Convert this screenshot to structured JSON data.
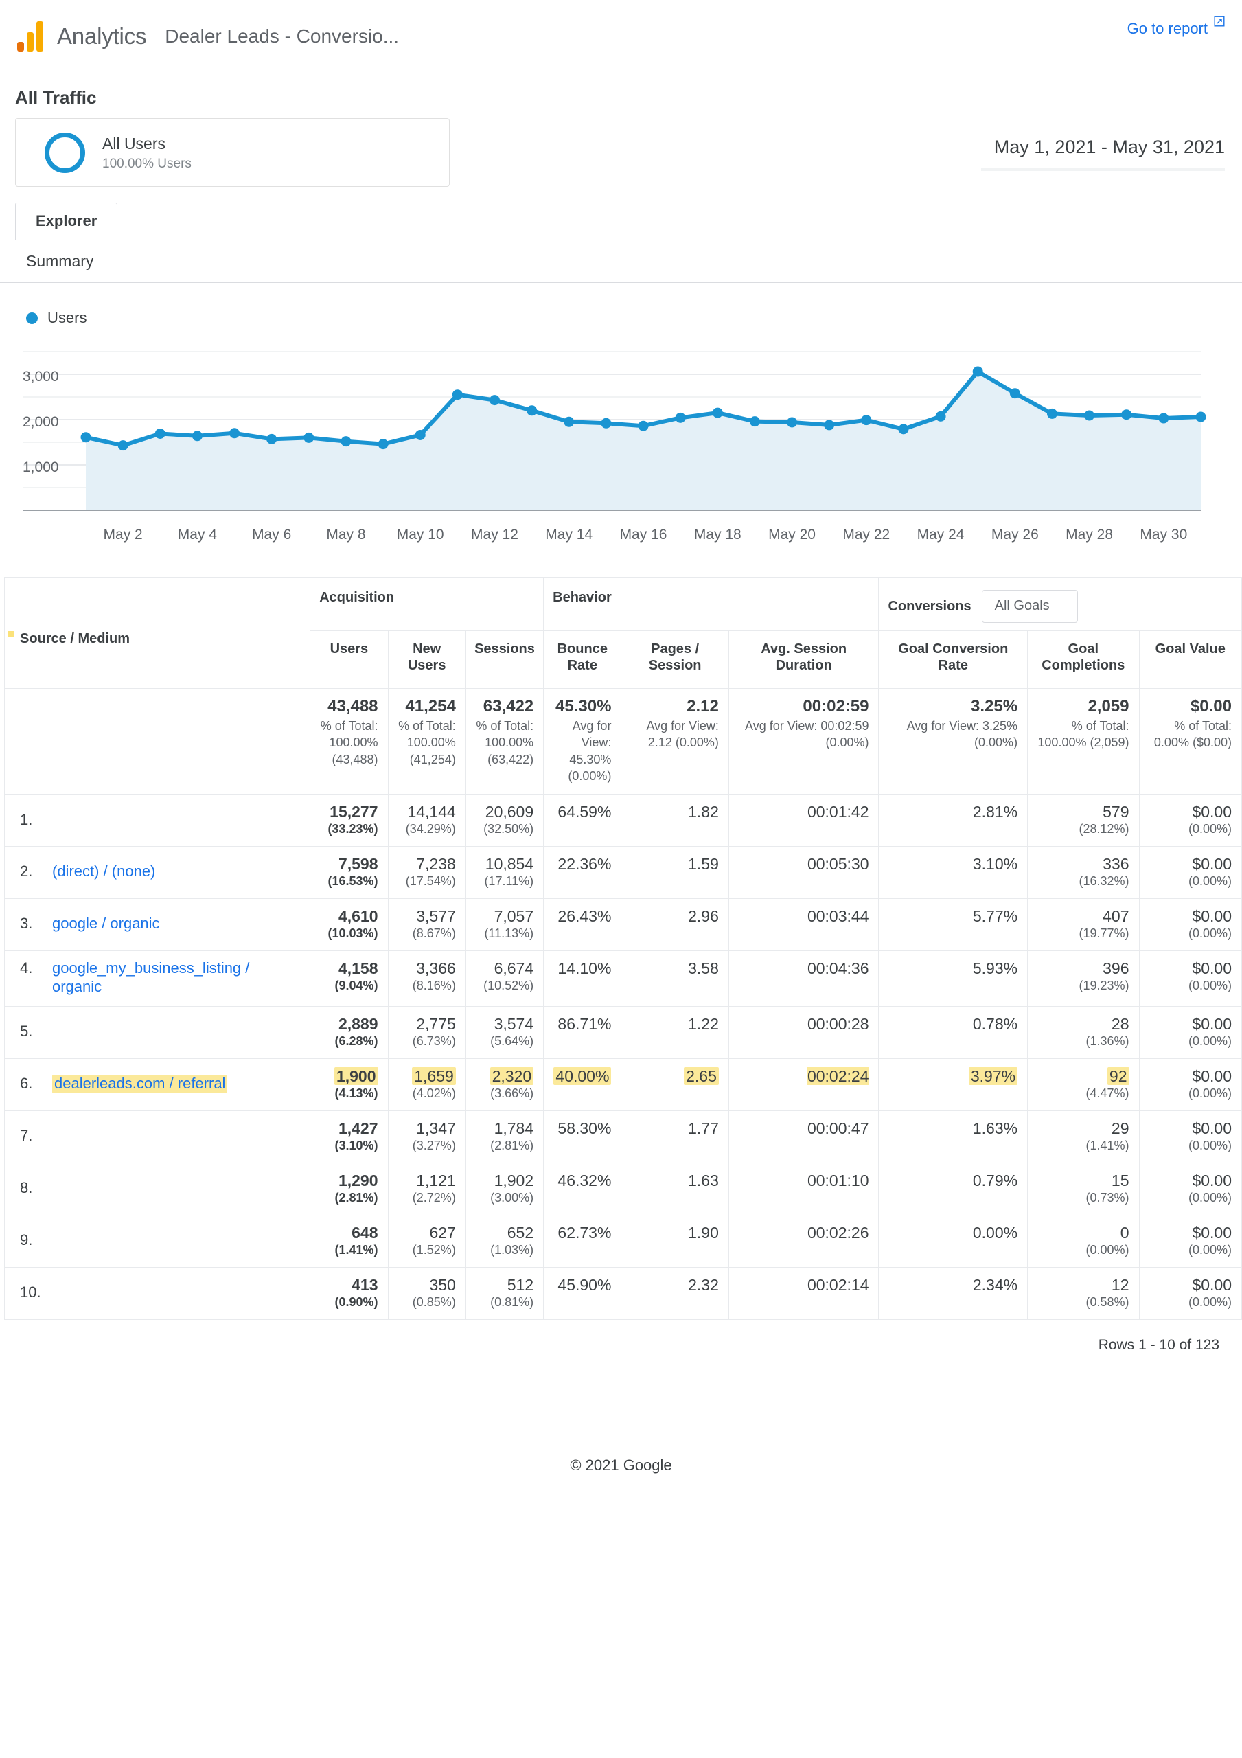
{
  "header": {
    "brand": "Analytics",
    "doc_title": "Dealer Leads - Conversio...",
    "go_to_report": "Go to report",
    "external_link_icon": "external-link-icon",
    "logo_icon": "google-analytics-logo-icon"
  },
  "page": {
    "title": "All Traffic",
    "date_range": "May 1, 2021 - May 31, 2021"
  },
  "segment": {
    "name": "All Users",
    "sub": "100.00% Users",
    "ring_icon": "segment-ring-icon"
  },
  "tabs": {
    "explorer": "Explorer",
    "summary": "Summary"
  },
  "chart_data": {
    "type": "line",
    "title": "",
    "subtitle": "",
    "xlabel": "",
    "ylabel": "",
    "legend": [
      "Users"
    ],
    "legend_position": "top-left",
    "grid": true,
    "ylim": [
      0,
      3500
    ],
    "yticks": [
      1000,
      2000,
      3000
    ],
    "ytick_labels": [
      "1,000",
      "2,000",
      "3,000"
    ],
    "xtick_labels": [
      "May 2",
      "May 4",
      "May 6",
      "May 8",
      "May 10",
      "May 12",
      "May 14",
      "May 16",
      "May 18",
      "May 20",
      "May 22",
      "May 24",
      "May 26",
      "May 28",
      "May 30"
    ],
    "x": [
      "May 1",
      "May 2",
      "May 3",
      "May 4",
      "May 5",
      "May 6",
      "May 7",
      "May 8",
      "May 9",
      "May 10",
      "May 11",
      "May 12",
      "May 13",
      "May 14",
      "May 15",
      "May 16",
      "May 17",
      "May 18",
      "May 19",
      "May 20",
      "May 21",
      "May 22",
      "May 23",
      "May 24",
      "May 25",
      "May 26",
      "May 27",
      "May 28",
      "May 29",
      "May 30",
      "May 31"
    ],
    "series": [
      {
        "name": "Users",
        "color": "#1a94d2",
        "fill": "#e4f0f7",
        "values": [
          1610,
          1430,
          1690,
          1640,
          1700,
          1570,
          1600,
          1520,
          1460,
          1660,
          2550,
          2430,
          2200,
          1950,
          1920,
          1860,
          2040,
          2150,
          1960,
          1940,
          1880,
          1990,
          1790,
          2070,
          3060,
          2580,
          2130,
          2090,
          2110,
          2030,
          2060
        ]
      }
    ]
  },
  "table": {
    "groups": [
      {
        "label": "Source / Medium",
        "kind": "dimension"
      },
      {
        "label": "Acquisition",
        "kind": "metric-group"
      },
      {
        "label": "Behavior",
        "kind": "metric-group"
      },
      {
        "label": "Conversions",
        "kind": "metric-group",
        "selector_value": "All Goals"
      }
    ],
    "columns": [
      "Users",
      "New Users",
      "Sessions",
      "Bounce Rate",
      "Pages / Session",
      "Avg. Session Duration",
      "Goal Conversion Rate",
      "Goal Completions",
      "Goal Value"
    ],
    "totals": [
      {
        "main": "43,488",
        "sub": "% of Total: 100.00% (43,488)"
      },
      {
        "main": "41,254",
        "sub": "% of Total: 100.00% (41,254)"
      },
      {
        "main": "63,422",
        "sub": "% of Total: 100.00% (63,422)"
      },
      {
        "main": "45.30%",
        "sub": "Avg for View: 45.30% (0.00%)"
      },
      {
        "main": "2.12",
        "sub": "Avg for View: 2.12 (0.00%)"
      },
      {
        "main": "00:02:59",
        "sub": "Avg for View: 00:02:59 (0.00%)"
      },
      {
        "main": "3.25%",
        "sub": "Avg for View: 3.25% (0.00%)"
      },
      {
        "main": "2,059",
        "sub": "% of Total: 100.00% (2,059)"
      },
      {
        "main": "$0.00",
        "sub": "% of Total: 0.00% ($0.00)"
      }
    ],
    "rows": [
      {
        "index": "1.",
        "source": "",
        "highlight": false,
        "users": "15,277",
        "users_pct": "(33.23%)",
        "new_users": "14,144",
        "new_users_pct": "(34.29%)",
        "sessions": "20,609",
        "sessions_pct": "(32.50%)",
        "bounce_rate": "64.59%",
        "pages_session": "1.82",
        "avg_duration": "00:01:42",
        "goal_conv_rate": "2.81%",
        "goal_completions": "579",
        "goal_completions_pct": "(28.12%)",
        "goal_value": "$0.00",
        "goal_value_pct": "(0.00%)"
      },
      {
        "index": "2.",
        "source": "(direct) / (none)",
        "highlight": false,
        "users": "7,598",
        "users_pct": "(16.53%)",
        "new_users": "7,238",
        "new_users_pct": "(17.54%)",
        "sessions": "10,854",
        "sessions_pct": "(17.11%)",
        "bounce_rate": "22.36%",
        "pages_session": "1.59",
        "avg_duration": "00:05:30",
        "goal_conv_rate": "3.10%",
        "goal_completions": "336",
        "goal_completions_pct": "(16.32%)",
        "goal_value": "$0.00",
        "goal_value_pct": "(0.00%)"
      },
      {
        "index": "3.",
        "source": "google / organic",
        "highlight": false,
        "users": "4,610",
        "users_pct": "(10.03%)",
        "new_users": "3,577",
        "new_users_pct": "(8.67%)",
        "sessions": "7,057",
        "sessions_pct": "(11.13%)",
        "bounce_rate": "26.43%",
        "pages_session": "2.96",
        "avg_duration": "00:03:44",
        "goal_conv_rate": "5.77%",
        "goal_completions": "407",
        "goal_completions_pct": "(19.77%)",
        "goal_value": "$0.00",
        "goal_value_pct": "(0.00%)"
      },
      {
        "index": "4.",
        "source": "google_my_business_listing / organic",
        "highlight": false,
        "users": "4,158",
        "users_pct": "(9.04%)",
        "new_users": "3,366",
        "new_users_pct": "(8.16%)",
        "sessions": "6,674",
        "sessions_pct": "(10.52%)",
        "bounce_rate": "14.10%",
        "pages_session": "3.58",
        "avg_duration": "00:04:36",
        "goal_conv_rate": "5.93%",
        "goal_completions": "396",
        "goal_completions_pct": "(19.23%)",
        "goal_value": "$0.00",
        "goal_value_pct": "(0.00%)"
      },
      {
        "index": "5.",
        "source": "",
        "highlight": false,
        "users": "2,889",
        "users_pct": "(6.28%)",
        "new_users": "2,775",
        "new_users_pct": "(6.73%)",
        "sessions": "3,574",
        "sessions_pct": "(5.64%)",
        "bounce_rate": "86.71%",
        "pages_session": "1.22",
        "avg_duration": "00:00:28",
        "goal_conv_rate": "0.78%",
        "goal_completions": "28",
        "goal_completions_pct": "(1.36%)",
        "goal_value": "$0.00",
        "goal_value_pct": "(0.00%)"
      },
      {
        "index": "6.",
        "source": "dealerleads.com / referral",
        "highlight": true,
        "users": "1,900",
        "users_pct": "(4.13%)",
        "new_users": "1,659",
        "new_users_pct": "(4.02%)",
        "sessions": "2,320",
        "sessions_pct": "(3.66%)",
        "bounce_rate": "40.00%",
        "pages_session": "2.65",
        "avg_duration": "00:02:24",
        "goal_conv_rate": "3.97%",
        "goal_completions": "92",
        "goal_completions_pct": "(4.47%)",
        "goal_value": "$0.00",
        "goal_value_pct": "(0.00%)"
      },
      {
        "index": "7.",
        "source": "",
        "highlight": false,
        "users": "1,427",
        "users_pct": "(3.10%)",
        "new_users": "1,347",
        "new_users_pct": "(3.27%)",
        "sessions": "1,784",
        "sessions_pct": "(2.81%)",
        "bounce_rate": "58.30%",
        "pages_session": "1.77",
        "avg_duration": "00:00:47",
        "goal_conv_rate": "1.63%",
        "goal_completions": "29",
        "goal_completions_pct": "(1.41%)",
        "goal_value": "$0.00",
        "goal_value_pct": "(0.00%)"
      },
      {
        "index": "8.",
        "source": "",
        "highlight": false,
        "users": "1,290",
        "users_pct": "(2.81%)",
        "new_users": "1,121",
        "new_users_pct": "(2.72%)",
        "sessions": "1,902",
        "sessions_pct": "(3.00%)",
        "bounce_rate": "46.32%",
        "pages_session": "1.63",
        "avg_duration": "00:01:10",
        "goal_conv_rate": "0.79%",
        "goal_completions": "15",
        "goal_completions_pct": "(0.73%)",
        "goal_value": "$0.00",
        "goal_value_pct": "(0.00%)"
      },
      {
        "index": "9.",
        "source": "",
        "highlight": false,
        "users": "648",
        "users_pct": "(1.41%)",
        "new_users": "627",
        "new_users_pct": "(1.52%)",
        "sessions": "652",
        "sessions_pct": "(1.03%)",
        "bounce_rate": "62.73%",
        "pages_session": "1.90",
        "avg_duration": "00:02:26",
        "goal_conv_rate": "0.00%",
        "goal_completions": "0",
        "goal_completions_pct": "(0.00%)",
        "goal_value": "$0.00",
        "goal_value_pct": "(0.00%)"
      },
      {
        "index": "10.",
        "source": "",
        "highlight": false,
        "users": "413",
        "users_pct": "(0.90%)",
        "new_users": "350",
        "new_users_pct": "(0.85%)",
        "sessions": "512",
        "sessions_pct": "(0.81%)",
        "bounce_rate": "45.90%",
        "pages_session": "2.32",
        "avg_duration": "00:02:14",
        "goal_conv_rate": "2.34%",
        "goal_completions": "12",
        "goal_completions_pct": "(0.58%)",
        "goal_value": "$0.00",
        "goal_value_pct": "(0.00%)"
      }
    ],
    "rows_count": "Rows 1 - 10 of 123"
  },
  "footer": {
    "copyright": "© 2021 Google"
  },
  "colors": {
    "accent": "#1a73e8",
    "series": "#1a94d2",
    "area_fill": "#e4f0f7",
    "highlight": "#fbe99a",
    "logo_orange": "#e8710a",
    "logo_yellow": "#f9ab00"
  }
}
